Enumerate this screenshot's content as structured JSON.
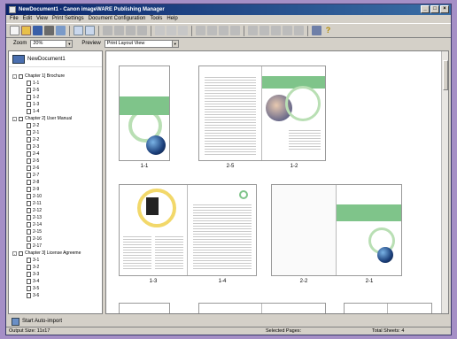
{
  "window": {
    "title": "NewDocument1 - Canon imageWARE Publishing Manager",
    "controls": [
      "_",
      "□",
      "×"
    ]
  },
  "menu": [
    "File",
    "Edit",
    "View",
    "Print Settings",
    "Document Configuration",
    "Tools",
    "Help"
  ],
  "zoom": {
    "label": "Zoom",
    "value": "20%"
  },
  "preview": {
    "label": "Preview",
    "value": "Print Layout View"
  },
  "tree": {
    "root": "NewDocument1",
    "chapters": [
      {
        "title": "Chapter 1] Brochure",
        "pages": [
          "1-1",
          "2-5",
          "1-2",
          "1-3",
          "1-4"
        ]
      },
      {
        "title": "Chapter 2] User Manual",
        "pages": [
          "2-2",
          "2-1",
          "2-2",
          "2-3",
          "2-4",
          "2-5",
          "2-6",
          "2-7",
          "2-8",
          "2-9",
          "2-10",
          "2-11",
          "2-12",
          "2-13",
          "2-14",
          "2-15",
          "2-16",
          "2-17"
        ]
      },
      {
        "title": "Chapter 3] License Agreeme",
        "pages": [
          "3-1",
          "3-2",
          "3-3",
          "3-4",
          "3-5",
          "3-6"
        ]
      }
    ]
  },
  "spreads": {
    "s1": "1-1",
    "s2a": "2-5",
    "s2b": "1-2",
    "s3a": "1-3",
    "s3b": "1-4",
    "s4a": "2-2",
    "s4b": "2-1"
  },
  "bottom": {
    "autoimport": "Start Auto-import",
    "output_size": "Output Size: 11x17",
    "selected": "Selected Pages:",
    "total": "Total Sheets: 4"
  },
  "colors": {
    "desktop": "#a58fc6",
    "titlebar": "#0a246a",
    "accent_green": "#7fc48a"
  }
}
